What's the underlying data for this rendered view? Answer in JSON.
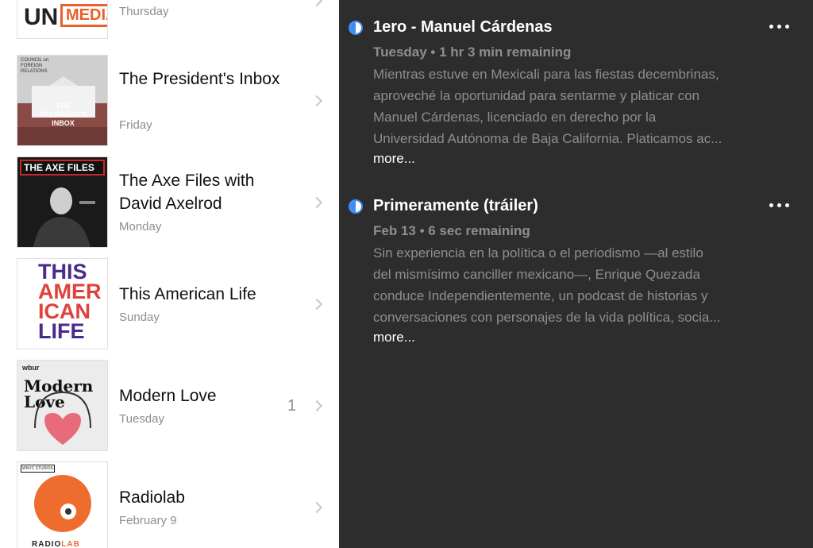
{
  "podcasts": [
    {
      "title": "",
      "day": "Thursday",
      "art": {
        "line1": "UN",
        "line2": "MEDIA"
      }
    },
    {
      "title": "The President's Inbox",
      "day": "Friday",
      "art": {
        "org": "COUNCIL on FOREIGN RELATIONS",
        "name": "THE PRESIDENT'S INBOX"
      }
    },
    {
      "title": "The Axe Files with David Axelrod",
      "day": "Monday",
      "art": {
        "name": "THE AXE FILES"
      }
    },
    {
      "title": "This American Life",
      "day": "Sunday",
      "art": {
        "l1": "THIS",
        "l2": "AMER",
        "l3": "ICAN",
        "l4": "LIFE"
      }
    },
    {
      "title": "Modern Love",
      "day": "Tuesday",
      "badge": "1",
      "art": {
        "brand": "wbur",
        "l1": "Modern",
        "l2": "Love"
      }
    },
    {
      "title": "Radiolab",
      "day": "February 9",
      "art": {
        "studio": "WNYC STUDIOS",
        "name1": "RADIO",
        "name2": "LAB"
      }
    }
  ],
  "episodes": [
    {
      "title": "1ero - Manuel Cárdenas",
      "meta": "Tuesday • 1 hr 3 min remaining",
      "desc": [
        "Mientras estuve en Mexicali para las fiestas decembrinas,",
        "aproveché la oportunidad para sentarme y platicar con",
        "Manuel Cárdenas, licenciado en derecho por la",
        "Universidad Autónoma de Baja California. Platicamos ac..."
      ],
      "more": "more..."
    },
    {
      "title": "Primeramente (tráiler)",
      "meta": "Feb 13 • 6 sec remaining",
      "desc": [
        "Sin experiencia en la política o el periodismo —al estilo",
        "del mismísimo canciller mexicano—, Enrique Quezada",
        "conduce Independientemente, un podcast de historias y",
        "conversaciones con personajes de la vida política, socia..."
      ],
      "more": "more..."
    }
  ],
  "colors": {
    "accent": "#3d8cf5",
    "dark_bg": "#2d2d2d",
    "muted": "#8e8e8e"
  }
}
